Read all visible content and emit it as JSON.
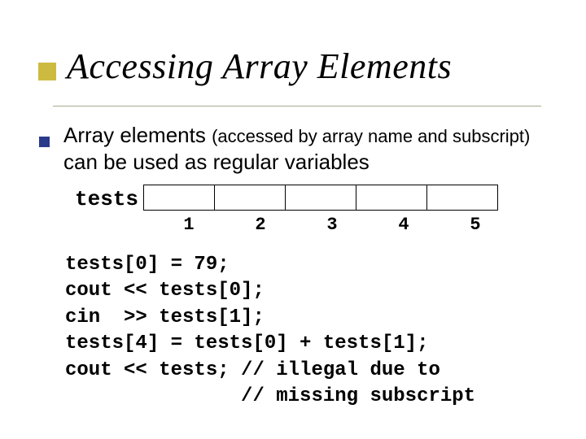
{
  "title": "Accessing Array Elements",
  "body": {
    "part1": "Array elements ",
    "part2": "(accessed by array name and subscript)",
    "part3": " can be used as regular variables"
  },
  "diagram": {
    "label": "tests",
    "indices": [
      "1",
      "2",
      "3",
      "4",
      "5"
    ]
  },
  "code": {
    "l1": "tests[0] = 79;",
    "l2": "cout << tests[0];",
    "l3": "cin  >> tests[1];",
    "l4": "tests[4] = tests[0] + tests[1];",
    "l5": "cout << tests; // illegal due to",
    "l6": "               // missing subscript"
  }
}
